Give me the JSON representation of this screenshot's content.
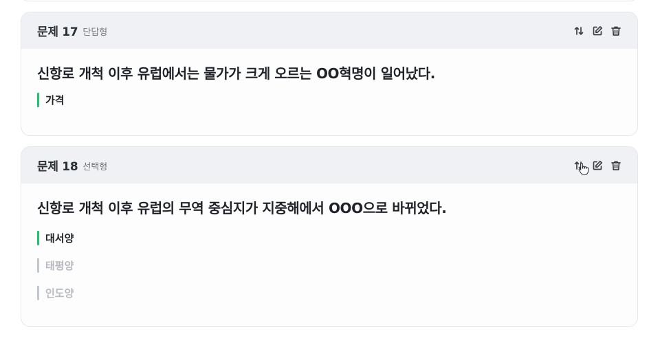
{
  "questions": [
    {
      "title": "문제 17",
      "type": "단답형",
      "text": "신항로 개척 이후 유럽에서는 물가가 크게 오르는 OO혁명이 일어났다.",
      "answers": [
        {
          "label": "가격",
          "correct": true
        }
      ]
    },
    {
      "title": "문제 18",
      "type": "선택형",
      "text": "신항로 개척 이후 유럽의 무역 중심지가 지중해에서 OOO으로 바뀌었다.",
      "answers": [
        {
          "label": "대서양",
          "correct": true
        },
        {
          "label": "태평양",
          "correct": false
        },
        {
          "label": "인도양",
          "correct": false
        }
      ]
    }
  ],
  "icons": {
    "reorder": "swap-vertical-icon",
    "edit": "edit-icon",
    "delete": "trash-icon"
  },
  "colors": {
    "header_bg": "#f0f1f4",
    "correct_bar": "#1ec36c",
    "wrong_bar": "#c3c6cc",
    "wrong_text": "#b7bac0"
  }
}
